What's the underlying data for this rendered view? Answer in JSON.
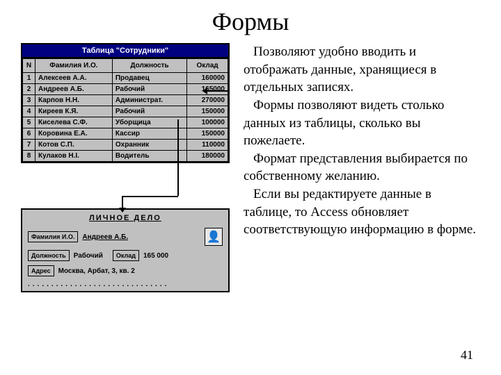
{
  "title": "Формы",
  "page_number": "41",
  "paragraphs": [
    "Позволяют удобно вводить и отображать данные, хранящиеся в отдельных записях.",
    "Формы позволяют видеть столько данных из таблицы, сколько вы пожелаете.",
    "Формат представления выбирается по собственному желанию.",
    "Если вы редактируете данные в таблице, то Access обновляет соответствующую информацию в форме."
  ],
  "table": {
    "caption": "Таблица \"Сотрудники\"",
    "headers": {
      "n": "N",
      "fio": "Фамилия И.О.",
      "pos": "Должность",
      "sal": "Оклад"
    },
    "rows": [
      {
        "n": "1",
        "fio": "Алексеев А.А.",
        "pos": "Продавец",
        "sal": "160000"
      },
      {
        "n": "2",
        "fio": "Андреев А.Б.",
        "pos": "Рабочий",
        "sal": "165000"
      },
      {
        "n": "3",
        "fio": "Карпов Н.Н.",
        "pos": "Администрат.",
        "sal": "270000"
      },
      {
        "n": "4",
        "fio": "Киреев К.Я.",
        "pos": "Рабочий",
        "sal": "150000"
      },
      {
        "n": "5",
        "fio": "Киселева С.Ф.",
        "pos": "Уборщица",
        "sal": "100000"
      },
      {
        "n": "6",
        "fio": "Коровина Е.А.",
        "pos": "Кассир",
        "sal": "150000"
      },
      {
        "n": "7",
        "fio": "Котов С.П.",
        "pos": "Охранник",
        "sal": "110000"
      },
      {
        "n": "8",
        "fio": "Кулаков Н.І.",
        "pos": "Водитель",
        "sal": "180000"
      }
    ]
  },
  "form": {
    "title": "ЛИЧНОЕ ДЕЛО",
    "labels": {
      "fio": "Фамилия И.О.",
      "pos": "Должность",
      "sal": "Оклад",
      "addr": "Адрес"
    },
    "values": {
      "fio": "Андреев А.Б.",
      "pos": "Рабочий",
      "sal": "165 000",
      "addr": "Москва, Арбат, 3, кв. 2"
    },
    "avatar": "👤"
  }
}
